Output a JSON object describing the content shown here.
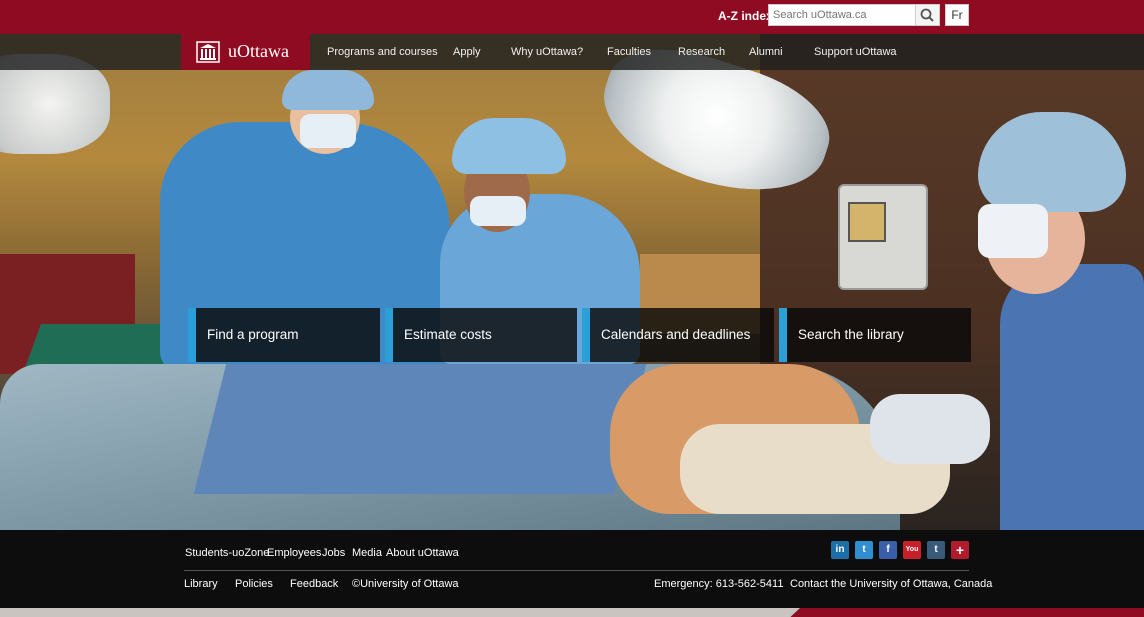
{
  "topbar": {
    "az_index": "A-Z index",
    "search_placeholder": "Search uOttawa.ca",
    "lang_toggle": "Fr"
  },
  "logo": {
    "name": "uOttawa"
  },
  "nav": {
    "items": [
      "Programs and courses",
      "Apply",
      "Why uOttawa?",
      "Faculties",
      "Research",
      "Alumni",
      "Support uOttawa"
    ]
  },
  "tiles": [
    "Find a program",
    "Estimate costs",
    "Calendars and deadlines",
    "Search the library"
  ],
  "footer": {
    "row1": [
      "Students-uoZone",
      "Employees",
      "Jobs",
      "Media",
      "About uOttawa"
    ],
    "row2": [
      "Library",
      "Policies",
      "Feedback",
      "©University of Ottawa"
    ],
    "emergency": "Emergency: 613-562-5411",
    "contact": "Contact the University of Ottawa, Canada",
    "social": [
      {
        "icon": "linkedin-icon",
        "glyph": "in",
        "color": "#1b6ea8"
      },
      {
        "icon": "twitter-icon",
        "glyph": "t",
        "color": "#2f8fd0"
      },
      {
        "icon": "facebook-icon",
        "glyph": "f",
        "color": "#3b5ea8"
      },
      {
        "icon": "youtube-icon",
        "glyph": "You",
        "color": "#c8202a"
      },
      {
        "icon": "tumblr-icon",
        "glyph": "t",
        "color": "#3a5a7a"
      },
      {
        "icon": "more-icon",
        "glyph": "+",
        "color": "#b01c2e"
      }
    ]
  },
  "colors": {
    "brand": "#8f0b22",
    "tile_accent": "#2a9fd8"
  }
}
